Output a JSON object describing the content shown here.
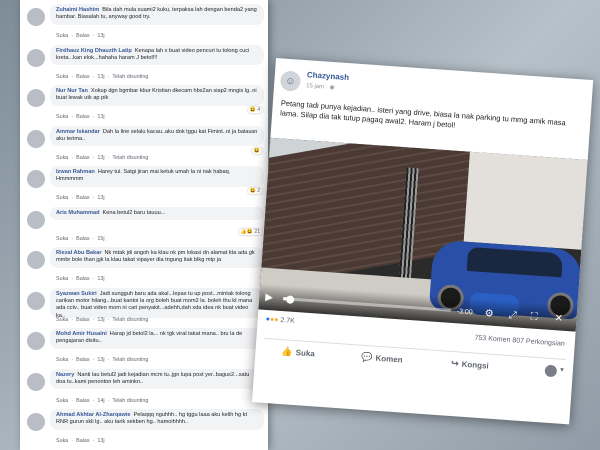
{
  "colors": {
    "link": "#385898",
    "bubble": "#f2f3f5",
    "like": "#1877f2",
    "car": "#2a4fa8"
  },
  "comments": [
    {
      "author": "Zuhaimi Hashim",
      "text": "Bila dah mula suami2 kuku, terpaksa lah dengan benda2 yang hambar. Biasalah tu, anyway good try.",
      "actions": [
        "Suka",
        "Balas",
        "13j"
      ],
      "edit": ""
    },
    {
      "author": "Firdhauz King Dhauzth Latip",
      "text": "Kenapa lah x buat video pencuri tu tolong cuci kreta...kan elok...hahaha haram J betol!!!",
      "actions": [
        "Suka",
        "Balas",
        "13j"
      ],
      "edit": "Telah disunting"
    },
    {
      "author": "Nur Nur Tan",
      "text": "Xokup dgn bgmbar kbur Kristian dkecam hbs2an siap2 mngis lg..ni buat lewak utk ap pik",
      "actions": [
        "Suka",
        "Balas",
        "13j"
      ],
      "edit": "",
      "reacts": "😆 4"
    },
    {
      "author": "Ammar Iskandar",
      "text": "Dah la line selalu kacau..aku dok tggu kat Fimint..ni ja balasan aku terima..",
      "actions": [
        "Suka",
        "Balas",
        "13j"
      ],
      "edit": "Telah disunting",
      "reacts": "😆"
    },
    {
      "author": "Izwan Rahman",
      "text": "Harey tui. Satgi jiran mai ketuk umah la ni nak habaq. Hmmmmm",
      "actions": [
        "Suka",
        "Balas",
        "13j"
      ],
      "edit": "",
      "reacts": "😆 2"
    },
    {
      "author": "Aris Muhammad",
      "text": "Kena betul2 baru tauuu...",
      "actions": [
        "Suka",
        "Balas",
        "15j"
      ],
      "edit": "",
      "reacts": "👍😆 21"
    },
    {
      "author": "Riezal Abu Bakar",
      "text": "Nk mtak jdi angoh ka klau nk pm lokasi dn alamat kta ada gk mmbr bole than jgk la klau takat vipayer dia tngung itak blkg mtp ja",
      "actions": [
        "Suka",
        "Balas",
        "13j"
      ],
      "edit": ""
    },
    {
      "author": "Syazwan Sukiri",
      "text": "Jadi sungguh baru ada akal...lepas tu up post...mintak tolong carikan motor hilang...buat kantoi la org boleh buat mom2 la. boleh thu kt mana ada cctv.. buat video mom ni cari penyakit...adehh,dah xda idea nk buat video ka..",
      "actions": [
        "Suka",
        "Balas",
        "13j"
      ],
      "edit": "Telah disunting"
    },
    {
      "author": "Mohd Amir Husaini",
      "text": "Harap jd betol2 la... nk tgk viral takat mana.. bru la de pengajaran disitu..",
      "actions": [
        "Suka",
        "Balas",
        "13j"
      ],
      "edit": "Telah disunting"
    },
    {
      "author": "Nazery",
      "text": "Nanti lau betul2 jadi kejadian mcm tu..jgn lupa post yer..bagus2...satu doa tu..kami penonton leh aminkn..",
      "actions": [
        "Suka",
        "Balas",
        "14j"
      ],
      "edit": "Telah disunting"
    },
    {
      "author": "Ahmad Akhtar Al-Zharqawie",
      "text": "Pelaqqq nguhhh.. hg tggu laaa aku kelih hg kt RNR gurun skli lg.. aku tarik sekben hg.. hamoihhhh..",
      "actions": [
        "Suka",
        "Balas",
        "13j"
      ],
      "edit": ""
    }
  ],
  "post": {
    "author": "Chazynash",
    "time": "15 jam",
    "globe_icon": "globe-icon",
    "text": "Petang tadi punya kejadian.. isteri yang drive, biasa la nak parking tu mmg amik masa lama. Silap dia tak tutup pagaq awal2. Haram j betol!",
    "video": {
      "time_remaining": "-3:00",
      "progress": 0.03
    },
    "reactions_count": "2.7K",
    "comments_count": "753 Komen",
    "shares_count": "807 Perkongsian",
    "actions": {
      "like": "Suka",
      "comment": "Komen",
      "share": "Kongsi"
    }
  }
}
